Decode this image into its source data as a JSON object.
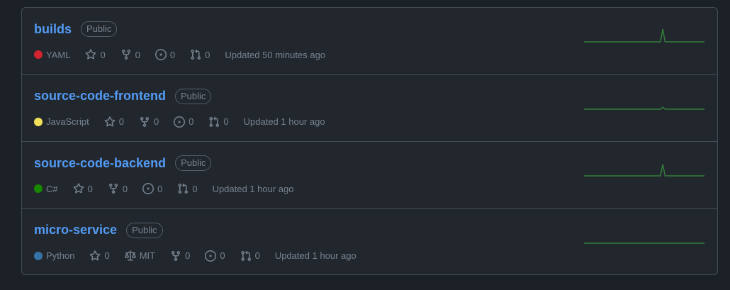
{
  "repos": [
    {
      "name": "builds",
      "visibility": "Public",
      "language": "YAML",
      "language_color": "#d1242f",
      "stars": "0",
      "forks": "0",
      "issues": "0",
      "pulls": "0",
      "updated": "Updated 50 minutes ago",
      "activity": [
        0,
        0,
        0,
        0,
        0,
        0,
        0,
        0,
        0,
        0,
        0,
        0,
        0,
        0,
        0,
        0,
        0,
        0,
        0,
        0,
        0,
        0,
        0,
        0,
        0,
        0,
        0,
        0,
        0,
        0,
        0,
        0,
        0,
        0,
        1,
        0,
        0,
        0,
        0,
        0,
        0,
        0,
        0,
        0,
        0,
        0,
        0,
        0,
        0,
        0,
        0,
        0,
        0
      ]
    },
    {
      "name": "source-code-frontend",
      "visibility": "Public",
      "language": "JavaScript",
      "language_color": "#f1e05a",
      "stars": "0",
      "forks": "0",
      "issues": "0",
      "pulls": "0",
      "updated": "Updated 1 hour ago",
      "activity": [
        0,
        0,
        0,
        0,
        0,
        0,
        0,
        0,
        0,
        0,
        0,
        0,
        0,
        0,
        0,
        0,
        0,
        0,
        0,
        0,
        0,
        0,
        0,
        0,
        0,
        0,
        0,
        0,
        0,
        0,
        0,
        0,
        0,
        0,
        0.15,
        0,
        0,
        0,
        0,
        0,
        0,
        0,
        0,
        0,
        0,
        0,
        0,
        0,
        0,
        0,
        0,
        0,
        0
      ]
    },
    {
      "name": "source-code-backend",
      "visibility": "Public",
      "language": "C#",
      "language_color": "#178600",
      "stars": "0",
      "forks": "0",
      "issues": "0",
      "pulls": "0",
      "updated": "Updated 1 hour ago",
      "activity": [
        0,
        0,
        0,
        0,
        0,
        0,
        0,
        0,
        0,
        0,
        0,
        0,
        0,
        0,
        0,
        0,
        0,
        0,
        0,
        0,
        0,
        0,
        0,
        0,
        0,
        0,
        0,
        0,
        0,
        0,
        0,
        0,
        0,
        0,
        0.9,
        0,
        0,
        0,
        0,
        0,
        0,
        0,
        0,
        0,
        0,
        0,
        0,
        0,
        0,
        0,
        0,
        0,
        0
      ]
    },
    {
      "name": "micro-service",
      "visibility": "Public",
      "language": "Python",
      "language_color": "#3572A5",
      "stars": "0",
      "license": "MIT",
      "forks": "0",
      "issues": "0",
      "pulls": "0",
      "updated": "Updated 1 hour ago",
      "activity": [
        0,
        0,
        0,
        0,
        0,
        0,
        0,
        0,
        0,
        0,
        0,
        0,
        0,
        0,
        0,
        0,
        0,
        0,
        0,
        0,
        0,
        0,
        0,
        0,
        0,
        0,
        0,
        0,
        0,
        0,
        0,
        0,
        0,
        0,
        0,
        0,
        0,
        0,
        0,
        0,
        0,
        0,
        0,
        0,
        0,
        0,
        0,
        0,
        0,
        0,
        0,
        0,
        0
      ]
    }
  ],
  "spark_color": "#347d39"
}
